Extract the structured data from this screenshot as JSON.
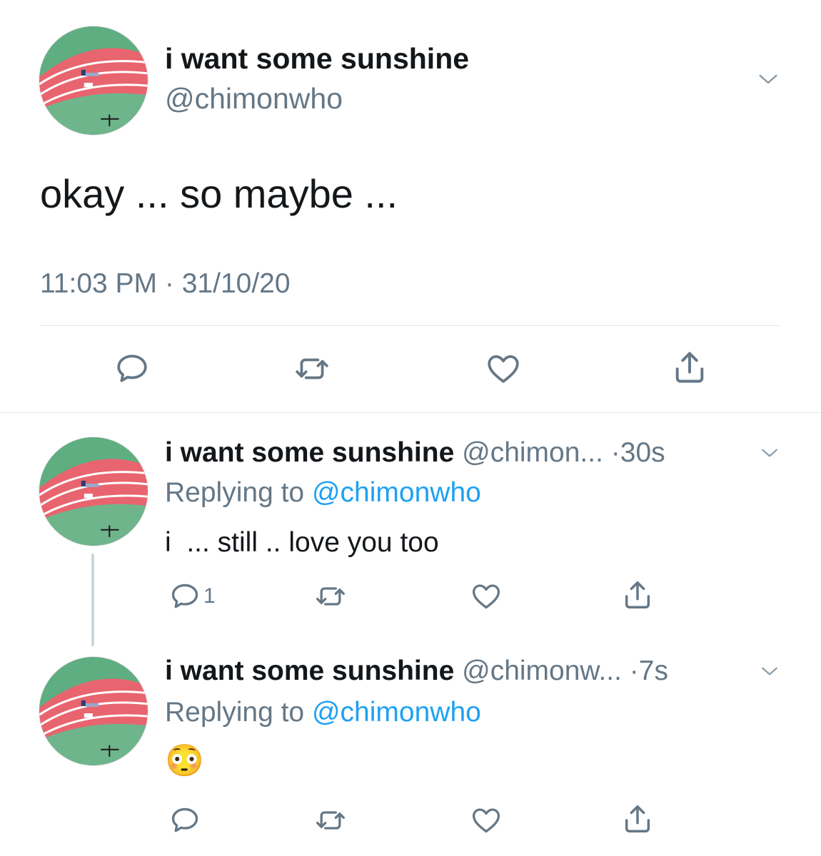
{
  "main_tweet": {
    "display_name": "i want some sunshine",
    "handle": "@chimonwho",
    "text": "okay ... so maybe ...",
    "time": "11:03 PM",
    "date": "31/10/20",
    "separator": "·"
  },
  "replies": [
    {
      "display_name": "i want some sunshine",
      "handle": "@chimon...",
      "age": "·30s",
      "replying_prefix": "Replying to",
      "replying_to": "@chimonwho",
      "text": "i  ... still .. love you too",
      "reply_count": "1"
    },
    {
      "display_name": "i want some sunshine",
      "handle": "@chimonw...",
      "age": "·7s",
      "replying_prefix": "Replying to",
      "replying_to": "@chimonwho",
      "text": "😳",
      "reply_count": ""
    }
  ],
  "icons": {
    "reply": "reply-icon",
    "retweet": "retweet-icon",
    "like": "heart-icon",
    "share": "share-icon",
    "more": "chevron-down-icon"
  },
  "colors": {
    "text": "#14171a",
    "secondary": "#657786",
    "link": "#1da1f2",
    "divider": "#e1e8ed"
  }
}
